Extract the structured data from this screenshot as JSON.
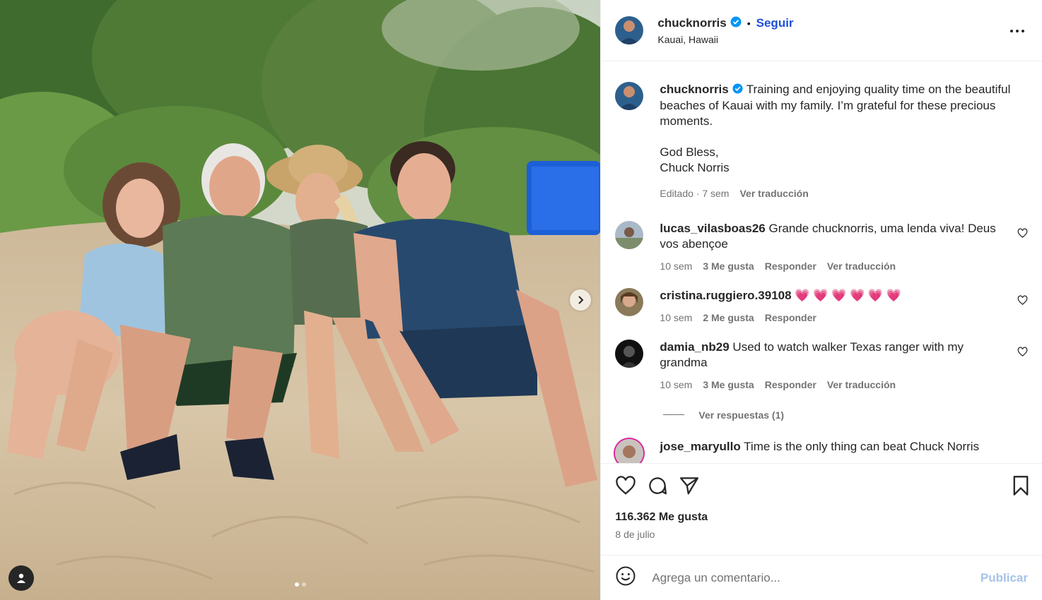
{
  "post": {
    "username": "chucknorris",
    "follow_label": "Seguir",
    "location": "Kauai, Hawaii",
    "caption_lines": [
      "Training and enjoying quality time on the beautiful beaches of Kauai with my family. I’m grateful for these precious moments.",
      "God Bless,",
      "Chuck Norris"
    ],
    "caption_edited": "Editado · 7 sem",
    "caption_translate": "Ver traducción",
    "likes": "116.362 Me gusta",
    "date": "8 de julio",
    "carousel": {
      "slides": 2,
      "active": 1
    }
  },
  "comments": [
    {
      "user": "lucas_vilasboas26",
      "text": "Grande chucknorris, uma lenda viva! Deus vos abençoe",
      "time": "10 sem",
      "likes": "3 Me gusta",
      "reply": "Responder",
      "translate": "Ver traducción"
    },
    {
      "user": "cristina.ruggiero.39108",
      "text": "💗 💗 💗 💗 💗 💗",
      "time": "10 sem",
      "likes": "2 Me gusta",
      "reply": "Responder"
    },
    {
      "user": "damia_nb29",
      "text": "Used to watch walker Texas ranger with my grandma",
      "time": "10 sem",
      "likes": "3 Me gusta",
      "reply": "Responder",
      "translate": "Ver traducción",
      "view_replies": "Ver respuestas (1)"
    },
    {
      "user": "jose_maryullo",
      "text": "Time is the only thing can beat Chuck Norris"
    }
  ],
  "add_comment": {
    "placeholder": "Agrega un comentario...",
    "publish": "Publicar"
  },
  "icons": {
    "more": "more-horizontal-icon",
    "verified": "verified-badge-icon",
    "like": "heart-icon",
    "comment": "comment-icon",
    "share": "share-icon",
    "save": "bookmark-icon",
    "emoji": "emoji-icon",
    "next": "chevron-right-icon",
    "tag": "user-tag-icon"
  },
  "colors": {
    "accent": "#0095f6",
    "verified": "#0095f6",
    "muted": "#737373"
  }
}
